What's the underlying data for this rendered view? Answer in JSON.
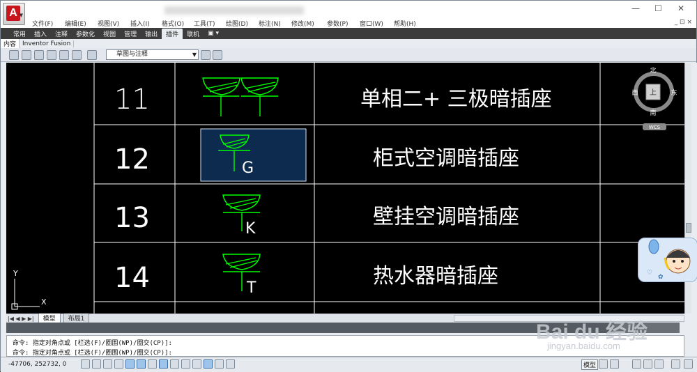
{
  "window": {
    "controls": [
      "—",
      "☐",
      "✕"
    ],
    "menu_right": "_ ⊡ ×"
  },
  "menu": {
    "items": [
      "文件(F)",
      "编辑(E)",
      "视图(V)",
      "插入(I)",
      "格式(O)",
      "工具(T)",
      "绘图(D)",
      "标注(N)",
      "修改(M)",
      "参数(P)",
      "窗口(W)",
      "帮助(H)"
    ]
  },
  "ribbon": {
    "tabs": [
      "常用",
      "插入",
      "注释",
      "参数化",
      "视图",
      "管理",
      "输出",
      "插件",
      "联机"
    ],
    "active_tab": "插件"
  },
  "subtabs": {
    "items": [
      "内容",
      "Inventor Fusion"
    ]
  },
  "toolbar": {
    "workspace": "草图与注释"
  },
  "drawing": {
    "rows": [
      {
        "num": "11",
        "label": "单相二+ 三极暗插座",
        "letter": ""
      },
      {
        "num": "12",
        "label": "柜式空调暗插座",
        "letter": "G"
      },
      {
        "num": "13",
        "label": "壁挂空调暗插座",
        "letter": "K"
      },
      {
        "num": "14",
        "label": "热水器暗插座",
        "letter": "T"
      }
    ],
    "viewcube": {
      "north": "北",
      "south": "南",
      "east": "东",
      "west": "西",
      "face": "上",
      "wcs": "WCS"
    },
    "ucs": {
      "x": "X",
      "y": "Y"
    }
  },
  "layout_tabs": {
    "nav": "|◀ ◀ ▶ ▶|",
    "items": [
      "模型",
      "布局1"
    ],
    "active": "模型"
  },
  "command": {
    "line1": "命令: 指定对角点或 [栏选(F)/圈围(WP)/圈交(CP)]:",
    "line2": "命令: 指定对角点或 [栏选(F)/圈围(WP)/圈交(CP)]:"
  },
  "status": {
    "coords": "-47706, 252732, 0",
    "model_label": "模型"
  },
  "watermark": {
    "logo": "Bai du 经验",
    "url": "jingyan.baidu.com"
  },
  "colors": {
    "canvas_bg": "#000000",
    "line_white": "#ffffff",
    "symbol_green": "#00ff00",
    "selection_fill": "#0d2b4e",
    "selection_border": "#d8e6f5"
  }
}
